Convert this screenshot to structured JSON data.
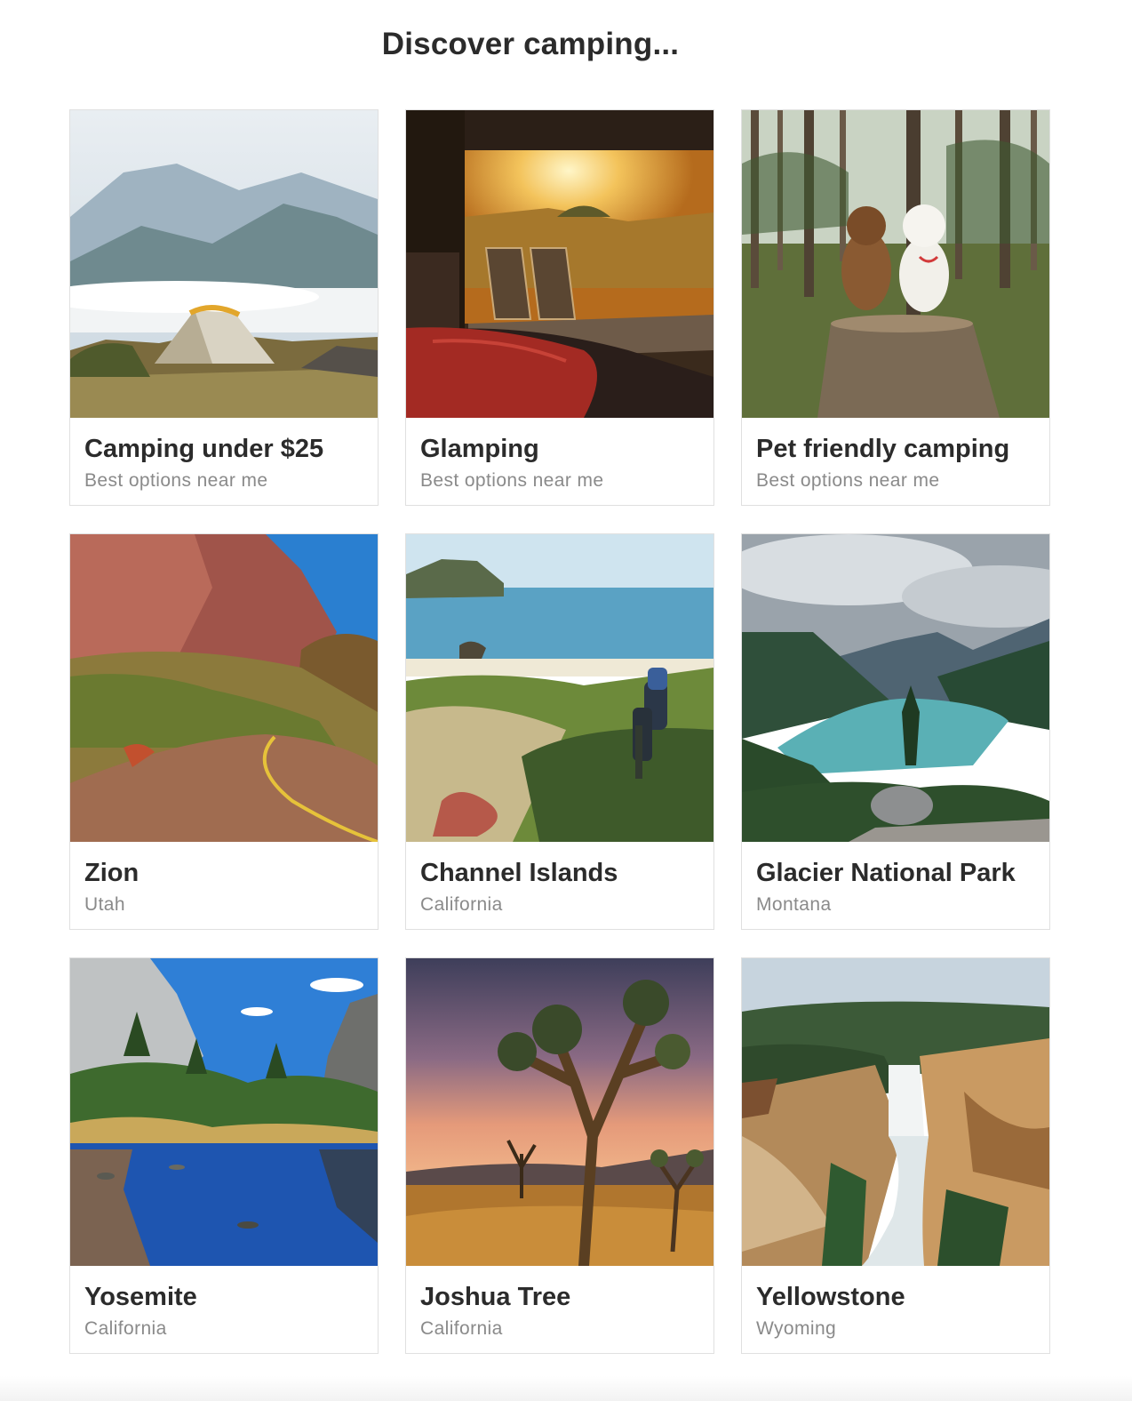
{
  "page": {
    "title": "Discover camping..."
  },
  "cards": [
    {
      "title": "Camping under $25",
      "subtitle": "Best options near me",
      "image": "tent-mountains"
    },
    {
      "title": "Glamping",
      "subtitle": "Best options near me",
      "image": "glamping-deck-sunset"
    },
    {
      "title": "Pet friendly camping",
      "subtitle": "Best options near me",
      "image": "dogs-on-stump-forest"
    },
    {
      "title": "Zion",
      "subtitle": "Utah",
      "image": "zion-canyon-road"
    },
    {
      "title": "Channel Islands",
      "subtitle": "California",
      "image": "coast-hikers"
    },
    {
      "title": "Glacier National Park",
      "subtitle": "Montana",
      "image": "glacier-lake"
    },
    {
      "title": "Yosemite",
      "subtitle": "California",
      "image": "yosemite-river"
    },
    {
      "title": "Joshua Tree",
      "subtitle": "California",
      "image": "joshua-tree-sunset"
    },
    {
      "title": "Yellowstone",
      "subtitle": "Wyoming",
      "image": "yellowstone-falls"
    }
  ]
}
